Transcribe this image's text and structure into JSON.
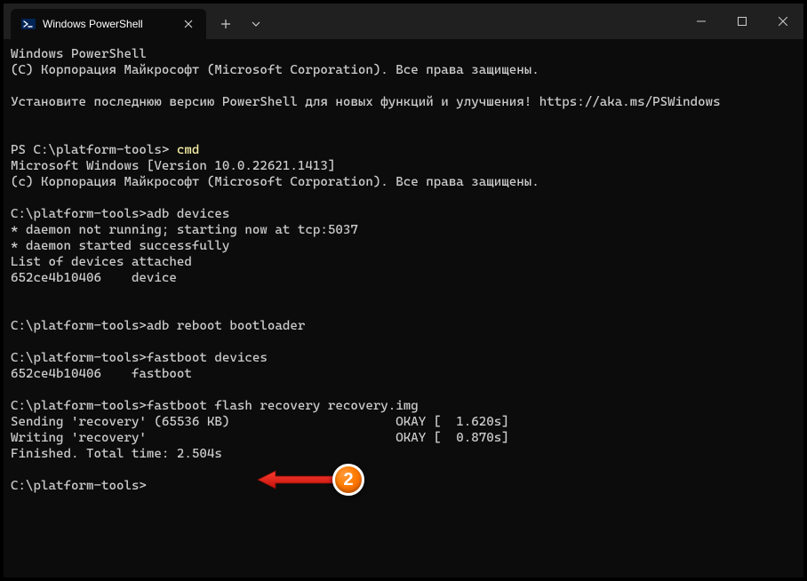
{
  "tab": {
    "title": "Windows PowerShell"
  },
  "terminal": {
    "l1": "Windows PowerShell",
    "l2": "(C) Корпорация Майкрософт (Microsoft Corporation). Все права защищены.",
    "l3": "",
    "l4": "Установите последнюю версию PowerShell для новых функций и улучшения! https://aka.ms/PSWindows",
    "l5": "",
    "l6": "",
    "l7p": "PS C:\\platform-tools> ",
    "l7c": "cmd",
    "l8": "Microsoft Windows [Version 10.0.22621.1413]",
    "l9": "(c) Корпорация Майкрософт (Microsoft Corporation). Все права защищены.",
    "l10": "",
    "l11": "C:\\platform-tools>adb devices",
    "l12": "* daemon not running; starting now at tcp:5037",
    "l13": "* daemon started successfully",
    "l14": "List of devices attached",
    "l15": "652ce4b10406    device",
    "l16": "",
    "l17": "",
    "l18": "C:\\platform-tools>adb reboot bootloader",
    "l19": "",
    "l20": "C:\\platform-tools>fastboot devices",
    "l21": "652ce4b10406    fastboot",
    "l22": "",
    "l23": "C:\\platform-tools>fastboot flash recovery recovery.img",
    "l24": "Sending 'recovery' (65536 KB)                      OKAY [  1.620s]",
    "l25": "Writing 'recovery'                                 OKAY [  0.870s]",
    "l26": "Finished. Total time: 2.504s",
    "l27": "",
    "l28": "C:\\platform-tools>"
  },
  "annotation": {
    "badge": "2"
  }
}
